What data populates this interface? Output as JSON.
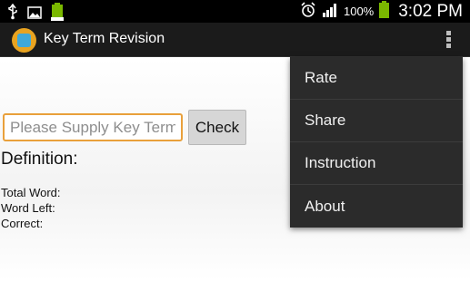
{
  "status_bar": {
    "battery_percent": "100%",
    "time": "3:02 PM",
    "icons": [
      "usb-icon",
      "image-icon",
      "battery-notification-icon",
      "alarm-icon",
      "signal-icon",
      "battery-icon"
    ]
  },
  "action_bar": {
    "title": "Key Term Revision",
    "overflow_icon": "overflow-menu-icon"
  },
  "form": {
    "key_term_placeholder": "Please Supply Key Term",
    "key_term_value": "",
    "check_label": "Check",
    "definition_label": "Definition:"
  },
  "stats": {
    "total_word_label": "Total Word:",
    "word_left_label": "Word Left:",
    "correct_label": "Correct:"
  },
  "menu": {
    "items": [
      {
        "label": "Rate"
      },
      {
        "label": "Share"
      },
      {
        "label": "Instruction"
      },
      {
        "label": "About"
      }
    ]
  },
  "colors": {
    "status_bar": "#000000",
    "action_bar": "#1b1b1b",
    "input_focus_border": "#e9a03b",
    "menu_background": "#2b2b2b",
    "battery_green": "#7ab800"
  }
}
